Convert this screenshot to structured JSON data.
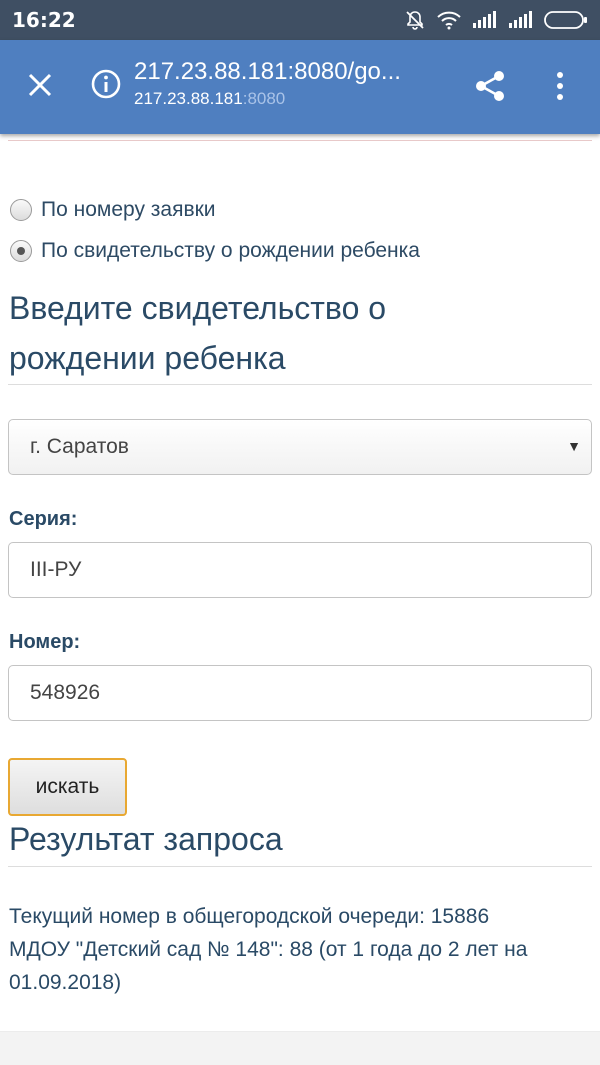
{
  "status_bar": {
    "time": "16:22"
  },
  "browser": {
    "url_title": "217.23.88.181:8080/go...",
    "url_host": "217.23.88.181",
    "url_port": ":8080"
  },
  "search_mode": {
    "options": [
      {
        "label": "По номеру заявки",
        "checked": false
      },
      {
        "label": "По свидетельству о рождении ребенка",
        "checked": true
      }
    ]
  },
  "form": {
    "heading_line1": "Введите свидетельство о",
    "heading_line2": "рождении ребенка",
    "city_value": "г. Саратов",
    "series_label": "Серия:",
    "series_value": "III-РУ",
    "number_label": "Номер:",
    "number_value": "548926",
    "search_button": "искать"
  },
  "result": {
    "heading": "Результат запроса",
    "line1": "Текущий номер в общегородской очереди: 15886",
    "line2": "МДОУ \"Детский сад № 148\": 88 (от 1 года до 2 лет на 01.09.2018)"
  },
  "colors": {
    "status_bar": "#3f4f63",
    "toolbar": "#4f7fc0",
    "text_heading": "#2a4a66",
    "button_border": "#e8a832"
  },
  "icons": [
    "muted-bell-icon",
    "wifi-icon",
    "signal-icon",
    "battery-icon",
    "close-icon",
    "info-icon",
    "share-icon",
    "more-vert-icon"
  ]
}
